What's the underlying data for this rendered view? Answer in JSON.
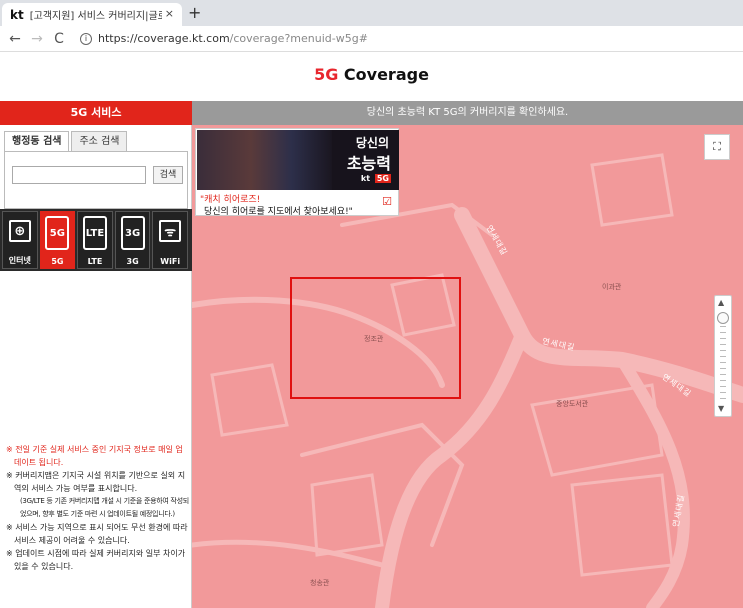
{
  "browser": {
    "tab_favicon": "kt",
    "tab_title": "[고객지원] 서비스 커버리지|글로",
    "tab_close": "×",
    "new_tab": "+",
    "back": "←",
    "forward": "→",
    "reload": "C",
    "url_main": "https://coverage.kt.com",
    "url_rest": "/coverage?menuid-w5g#"
  },
  "header": {
    "title_prefix": "5G",
    "title_rest": " Coverage"
  },
  "left_bar": "5G 서비스",
  "top_message": "당신의 초능력 KT 5G의 커버리지를 확인하세요.",
  "search": {
    "tabs": [
      "행정동 검색",
      "주소 검색"
    ],
    "input_value": "",
    "button": "검색"
  },
  "services": [
    {
      "label": "인터넷",
      "icon": "globe-icon",
      "glyph": "⊕",
      "active": false
    },
    {
      "label": "5G",
      "icon": "phone-5g-icon",
      "glyph": "5G",
      "active": true
    },
    {
      "label": "LTE",
      "icon": "phone-lte-icon",
      "glyph": "LTE",
      "active": false
    },
    {
      "label": "3G",
      "icon": "phone-3g-icon",
      "glyph": "3G",
      "active": false
    },
    {
      "label": "WiFi",
      "icon": "wifi-icon",
      "glyph": "ᯤ",
      "active": false
    }
  ],
  "notes": {
    "n1": "※ 전일 기준 실제 서비스 중인 기지국 정보로 매일 업데이트 됩니다.",
    "n2": "※ 커버리지맵은 기지국 시설 위치를 기반으로 실외 지역의 서비스 가능 여부를 표시합니다.",
    "n2_sub": "(3G/LTE 등 기존 커버리지맵 개설 시 기준을 준용하여 작성되었으며, 향후 별도 기준 마련 시 업데이트될 예정입니다.)",
    "n3": "※ 서비스 가능 지역으로 표시 되어도 무선 환경에 따라 서비스 제공이 어려울 수 있습니다.",
    "n4": "※ 업데이트 시점에 따라 실제 커버리지와 일부 차이가 있을 수 있습니다."
  },
  "banner": {
    "headline1": "당신의",
    "headline2": "초능력",
    "brand": "kt",
    "brand_5g": "5G",
    "text1": "\"캐치 히어로즈!",
    "text2": "당신의 히어로를 지도에서 찾아보세요!\"",
    "check": "☑"
  },
  "map": {
    "fullscreen": "⛶",
    "zoom_up": "▲",
    "zoom_down": "▼",
    "labels": {
      "road1": "연세대길",
      "road2": "연세대길",
      "road3": "연세대길",
      "road4": "연세대길",
      "bldg1": "이과관",
      "bldg2": "정조관",
      "bldg3": "중앙도서관",
      "bldg4": "청송관"
    },
    "colors": {
      "coverage": "#f2999a",
      "road": "#f6b8b8",
      "selection": "#e01010"
    }
  }
}
